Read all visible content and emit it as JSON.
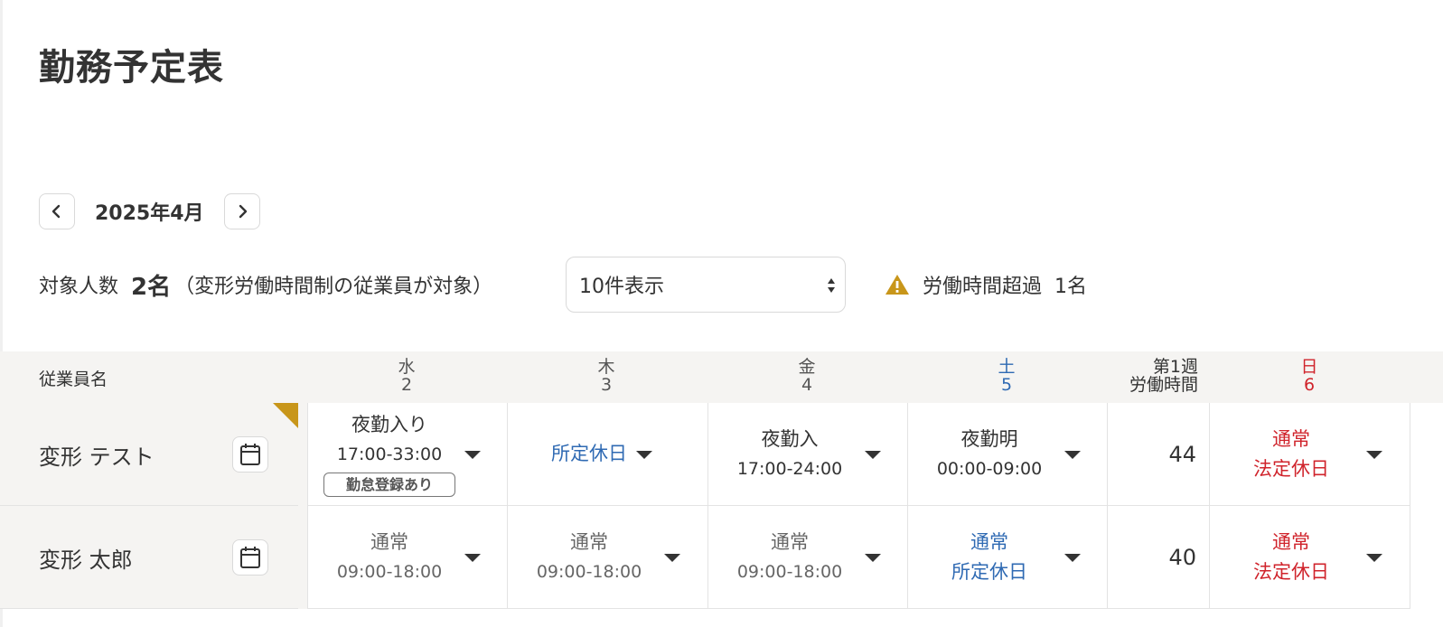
{
  "page": {
    "title": "勤務予定表"
  },
  "month_nav": {
    "month": "2025年4月"
  },
  "summary": {
    "count_label": "対象人数",
    "count_value": "2名",
    "count_note": "（変形労働時間制の従業員が対象）",
    "page_size_selected": "10件表示",
    "warning_label": "労働時間超過",
    "warning_count": "1名"
  },
  "table": {
    "name_header": "従業員名",
    "days": [
      {
        "weekday": "水",
        "date": "2"
      },
      {
        "weekday": "木",
        "date": "3"
      },
      {
        "weekday": "金",
        "date": "4"
      },
      {
        "weekday": "土",
        "date": "5"
      },
      {
        "weekday": "日",
        "date": "6"
      }
    ],
    "week_header_line1": "第1週",
    "week_header_line2": "労働時間",
    "rows": [
      {
        "name": "変形 テスト",
        "cells": [
          {
            "line1": "夜勤入り",
            "line2": "17:00-33:00",
            "badge": "勤怠登録あり"
          },
          {
            "line1": "所定休日"
          },
          {
            "line1": "夜勤入",
            "line2": "17:00-24:00"
          },
          {
            "line1": "夜勤明",
            "line2": "00:00-09:00"
          }
        ],
        "week_hours": "44",
        "sunday": {
          "line1": "通常",
          "line2": "法定休日"
        }
      },
      {
        "name": "変形 太郎",
        "cells": [
          {
            "line1": "通常",
            "line2": "09:00-18:00"
          },
          {
            "line1": "通常",
            "line2": "09:00-18:00"
          },
          {
            "line1": "通常",
            "line2": "09:00-18:00"
          },
          {
            "line1": "通常",
            "line2": "所定休日"
          }
        ],
        "week_hours": "40",
        "sunday": {
          "line1": "通常",
          "line2": "法定休日"
        }
      }
    ]
  },
  "colors": {
    "saturday": "#2f6ab3",
    "sunday": "#d0242c",
    "warning": "#c8961a",
    "header_bg": "#f5f4f2"
  },
  "icons": {
    "prev": "chevron-left-icon",
    "next": "chevron-right-icon",
    "warning": "warning-triangle-icon",
    "calendar": "calendar-icon",
    "dropdown": "caret-down-icon"
  }
}
